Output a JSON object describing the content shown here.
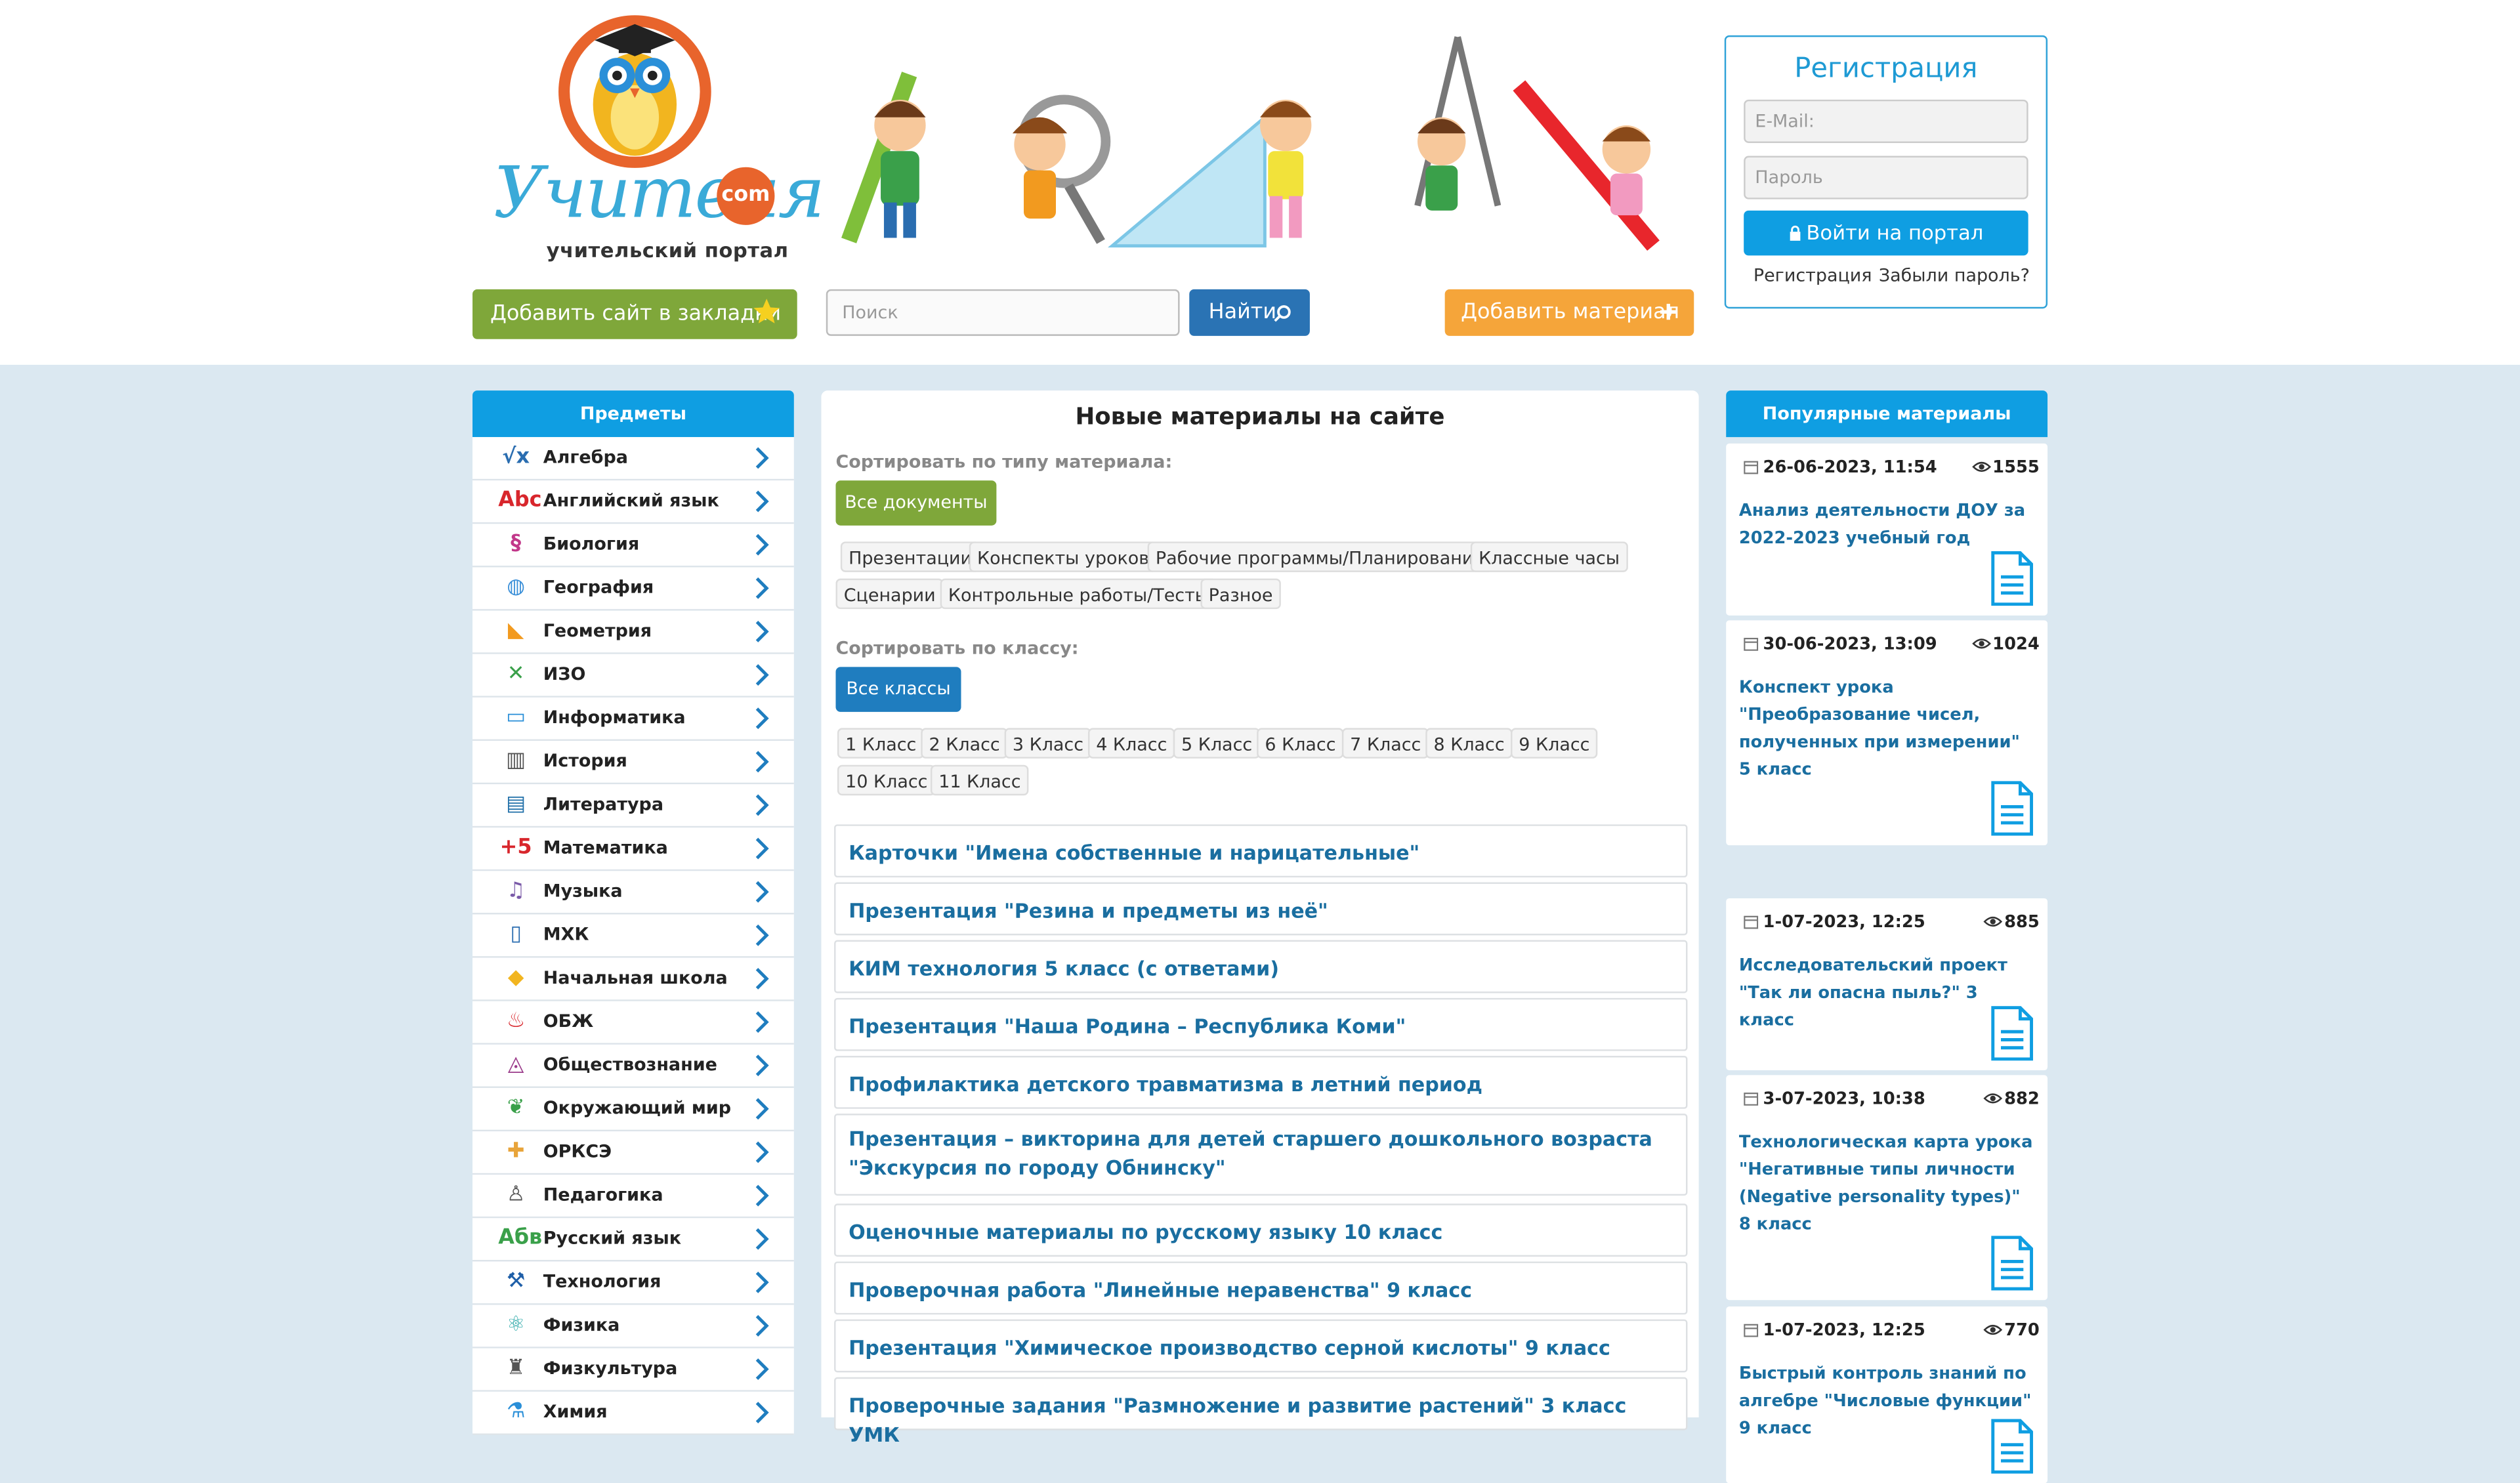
{
  "logo": {
    "main": "Учителя",
    "com": "com",
    "subtitle": "учительский портал"
  },
  "header": {
    "bookmark_label": "Добавить сайт в закладки",
    "search_placeholder": "Поиск",
    "find_label": "Найти",
    "add_material_label": "Добавить материал"
  },
  "registration": {
    "title": "Регистрация",
    "email_placeholder": "E-Mail:",
    "password_placeholder": "Пароль",
    "login_label": "Войти на портал",
    "register_link": "Регистрация",
    "forgot_link": "Забыли пароль?"
  },
  "subjects": {
    "title": "Предметы",
    "items": [
      {
        "label": "Алгебра",
        "icon": "sqrt-x-icon",
        "glyph": "√x",
        "color": "#2a6db0"
      },
      {
        "label": "Английский язык",
        "icon": "abc-icon",
        "glyph": "Abc",
        "color": "#d8262c"
      },
      {
        "label": "Биология",
        "icon": "dna-icon",
        "glyph": "§",
        "color": "#c2388a"
      },
      {
        "label": "География",
        "icon": "globe-icon",
        "glyph": "◍",
        "color": "#3a8fd8"
      },
      {
        "label": "Геометрия",
        "icon": "set-square-icon",
        "glyph": "◣",
        "color": "#f29a1f"
      },
      {
        "label": "ИЗО",
        "icon": "brushes-icon",
        "glyph": "✕",
        "color": "#3aa04a"
      },
      {
        "label": "Информатика",
        "icon": "monitor-icon",
        "glyph": "▭",
        "color": "#2a8fd8"
      },
      {
        "label": "История",
        "icon": "temple-icon",
        "glyph": "▥",
        "color": "#555555"
      },
      {
        "label": "Литература",
        "icon": "books-icon",
        "glyph": "▤",
        "color": "#1f6fa8"
      },
      {
        "label": "Математика",
        "icon": "plus-five-icon",
        "glyph": "+5",
        "color": "#d8262c"
      },
      {
        "label": "Музыка",
        "icon": "music-note-icon",
        "glyph": "♫",
        "color": "#7a5aa8"
      },
      {
        "label": "МХК",
        "icon": "open-book-icon",
        "glyph": "▯",
        "color": "#2a6db0"
      },
      {
        "label": "Начальная школа",
        "icon": "bell-icon",
        "glyph": "◆",
        "color": "#f2b51f"
      },
      {
        "label": "ОБЖ",
        "icon": "fire-icon",
        "glyph": "♨",
        "color": "#d8262c"
      },
      {
        "label": "Обществознание",
        "icon": "graduation-cap-icon",
        "glyph": "◬",
        "color": "#9a3a8a"
      },
      {
        "label": "Окружающий мир",
        "icon": "leaf-icon",
        "glyph": "❦",
        "color": "#3aa04a"
      },
      {
        "label": "ОРКСЭ",
        "icon": "cross-icon",
        "glyph": "✚",
        "color": "#e8a43a"
      },
      {
        "label": "Педагогика",
        "icon": "teacher-icon",
        "glyph": "♙",
        "color": "#555555"
      },
      {
        "label": "Русский язык",
        "icon": "abv-icon",
        "glyph": "Абв",
        "color": "#3aa04a"
      },
      {
        "label": "Технология",
        "icon": "hammer-icon",
        "glyph": "⚒",
        "color": "#1f5fa8"
      },
      {
        "label": "Физика",
        "icon": "atom-icon",
        "glyph": "⚛",
        "color": "#2aa8a8"
      },
      {
        "label": "Физкультура",
        "icon": "barbell-icon",
        "glyph": "♜",
        "color": "#555555"
      },
      {
        "label": "Химия",
        "icon": "flask-icon",
        "glyph": "⚗",
        "color": "#2a8fd8"
      }
    ]
  },
  "main": {
    "title": "Новые материалы на сайте",
    "sort_type_label": "Сортировать по типу материала:",
    "all_docs_label": "Все документы",
    "types": [
      "Презентации",
      "Конспекты уроков",
      "Рабочие программы/Планирование",
      "Классные часы",
      "Сценарии",
      "Контрольные работы/Тесты",
      "Разное"
    ],
    "sort_class_label": "Сортировать по классу:",
    "all_classes_label": "Все классы",
    "classes": [
      "1 Класс",
      "2 Класс",
      "3 Класс",
      "4 Класс",
      "5 Класс",
      "6 Класс",
      "7 Класс",
      "8 Класс",
      "9 Класс",
      "10 Класс",
      "11 Класс"
    ],
    "materials": [
      "Карточки \"Имена собственные и нарицательные\"",
      "Презентация \"Резина и предметы из неё\"",
      "КИМ технология 5 класс (с ответами)",
      "Презентация \"Наша Родина – Республика Коми\"",
      "Профилактика детского травматизма в летний период",
      "Презентация – викторина для детей старшего дошкольного возраста \"Экскурсия по городу Обнинску\"",
      "Оценочные материалы по русскому языку 10 класс",
      "Проверочная работа \"Линейные неравенства\" 9 класс",
      "Презентация \"Химическое производство серной кислоты\" 9 класс",
      "Проверочные задания \"Размножение и развитие растений\" 3 класс УМК"
    ]
  },
  "popular": {
    "title": "Популярные материалы",
    "items": [
      {
        "date": "26-06-2023, 11:54",
        "views": "1555",
        "title": "Анализ деятельности ДОУ за 2022-2023 учебный год"
      },
      {
        "date": "30-06-2023, 13:09",
        "views": "1024",
        "title": "Конспект урока \"Преобразование чисел, полученных при измерении\" 5 класс"
      },
      {
        "date": "1-07-2023, 12:25",
        "views": "885",
        "title": "Исследовательский проект \"Так ли опасна пыль?\" 3 класс"
      },
      {
        "date": "3-07-2023, 10:38",
        "views": "882",
        "title": "Технологическая карта урока \"Негативные типы личности (Negative personality types)\" 8 класс"
      },
      {
        "date": "1-07-2023, 12:25",
        "views": "770",
        "title": "Быстрый контроль знаний по алгебре \"Числовые функции\" 9 класс"
      }
    ]
  }
}
